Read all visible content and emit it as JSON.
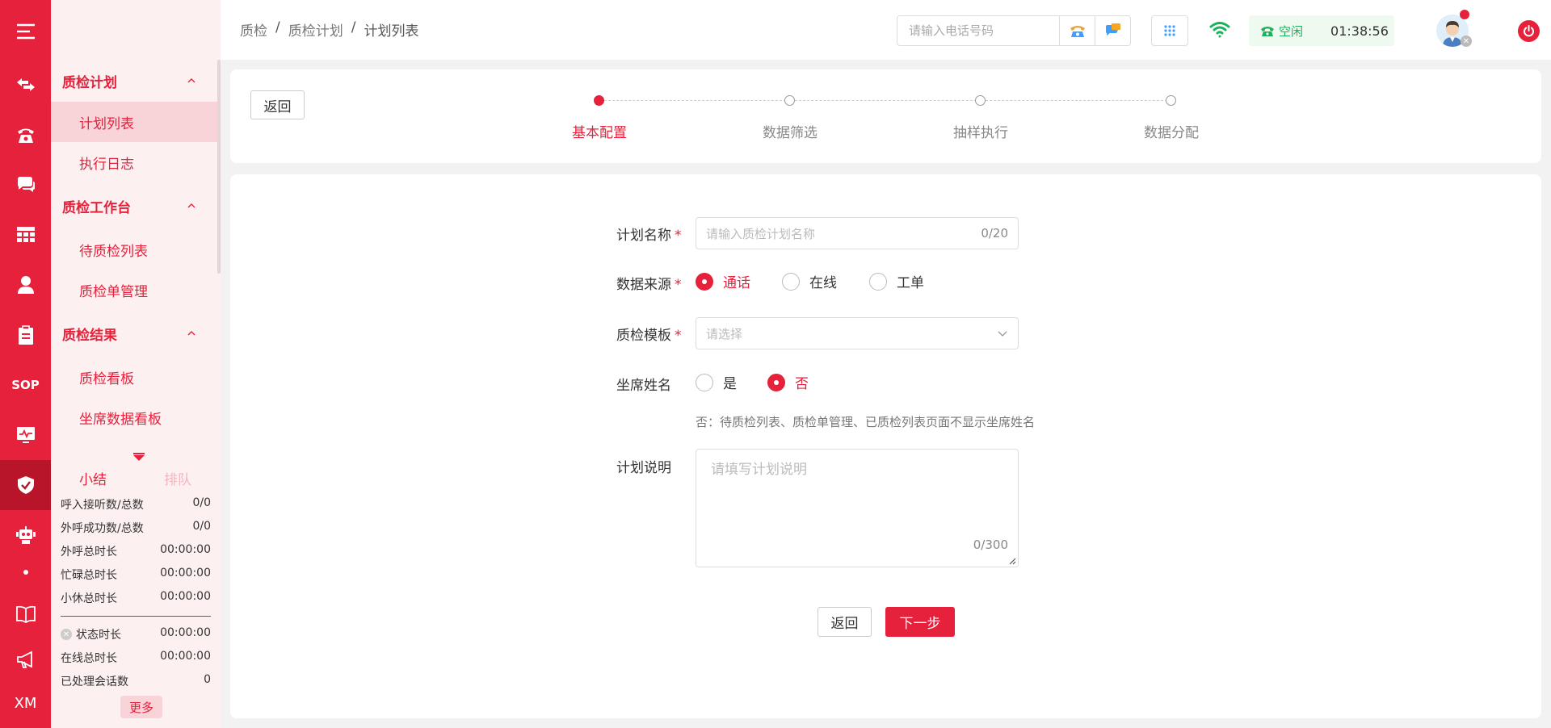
{
  "rail": {
    "items": [
      {
        "name": "menu-icon"
      },
      {
        "name": "transfer-icon"
      },
      {
        "name": "phone-icon"
      },
      {
        "name": "chat-icon"
      },
      {
        "name": "table-icon"
      },
      {
        "name": "user-icon"
      },
      {
        "name": "clipboard-icon"
      },
      {
        "name": "sop-icon",
        "text": "SOP"
      },
      {
        "name": "monitor-icon"
      },
      {
        "name": "shield-check-icon"
      },
      {
        "name": "robot-icon"
      },
      {
        "name": "book-icon"
      },
      {
        "name": "megaphone-icon"
      },
      {
        "name": "xm-icon",
        "text": "XM"
      }
    ]
  },
  "sidebar": {
    "groups": [
      {
        "label": "质检计划",
        "items": [
          {
            "label": "计划列表",
            "active": true
          },
          {
            "label": "执行日志"
          }
        ]
      },
      {
        "label": "质检工作台",
        "items": [
          {
            "label": "待质检列表"
          },
          {
            "label": "质检单管理"
          }
        ]
      },
      {
        "label": "质检结果",
        "items": [
          {
            "label": "质检看板"
          },
          {
            "label": "坐席数据看板"
          }
        ]
      }
    ]
  },
  "summary": {
    "tab_active": "小结",
    "tab_inactive": "排队",
    "stats": [
      {
        "label": "呼入接听数/总数",
        "value": "0/0"
      },
      {
        "label": "外呼成功数/总数",
        "value": "0/0"
      },
      {
        "label": "外呼总时长",
        "value": "00:00:00"
      },
      {
        "label": "忙碌总时长",
        "value": "00:00:00"
      },
      {
        "label": "小休总时长",
        "value": "00:00:00"
      }
    ],
    "stats2": [
      {
        "label": "状态时长",
        "value": "00:00:00"
      },
      {
        "label": "在线总时长",
        "value": "00:00:00"
      },
      {
        "label": "已处理会话数",
        "value": "0"
      }
    ],
    "more": "更多"
  },
  "header": {
    "breadcrumb": [
      "质检",
      "质检计划",
      "计划列表"
    ],
    "breadcrumb_sep": "/",
    "phone_placeholder": "请输入电话号码",
    "status": "空闲",
    "time": "01:38:56"
  },
  "steps": {
    "back": "返回",
    "items": [
      "基本配置",
      "数据筛选",
      "抽样执行",
      "数据分配"
    ],
    "active_index": 0
  },
  "form": {
    "plan_name": {
      "label": "计划名称",
      "required": "*",
      "placeholder": "请输入质检计划名称",
      "counter": "0/20"
    },
    "data_source": {
      "label": "数据来源",
      "required": "*",
      "options": [
        "通话",
        "在线",
        "工单"
      ],
      "selected": "通话"
    },
    "template": {
      "label": "质检模板",
      "required": "*",
      "placeholder": "请选择"
    },
    "agent_name": {
      "label": "坐席姓名",
      "options": [
        "是",
        "否"
      ],
      "selected": "否",
      "hint": "否：待质检列表、质检单管理、已质检列表页面不显示坐席姓名"
    },
    "description": {
      "label": "计划说明",
      "placeholder": "请填写计划说明",
      "counter": "0/300"
    },
    "back_label": "返回",
    "next_label": "下一步"
  },
  "colors": {
    "brand": "#e6213b",
    "status_green": "#16b35a"
  }
}
